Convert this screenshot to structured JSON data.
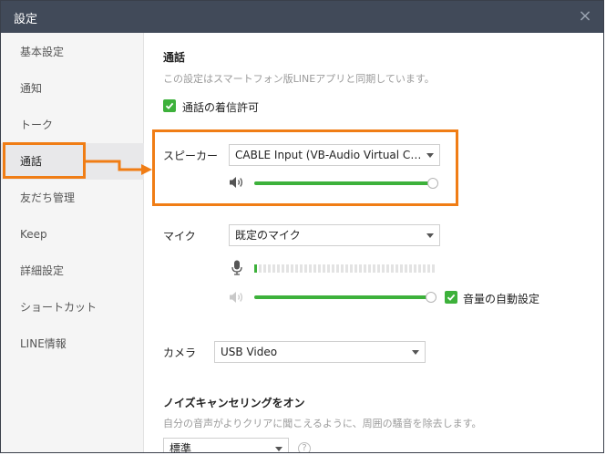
{
  "window": {
    "title": "設定",
    "close_glyph": "×"
  },
  "sidebar": {
    "items": [
      {
        "label": "基本設定"
      },
      {
        "label": "通知"
      },
      {
        "label": "トーク"
      },
      {
        "label": "通話",
        "active": true
      },
      {
        "label": "友だち管理"
      },
      {
        "label": "Keep"
      },
      {
        "label": "詳細設定"
      },
      {
        "label": "ショートカット"
      },
      {
        "label": "LINE情報"
      }
    ]
  },
  "call": {
    "heading": "通話",
    "description": "この設定はスマートフォン版LINEアプリと同期しています。",
    "allow_incoming": {
      "label": "通話の着信許可",
      "checked": true
    }
  },
  "speaker": {
    "label": "スピーカー",
    "selected": "CABLE Input (VB-Audio Virtual Cable)",
    "volume_percent": 100
  },
  "mic": {
    "label": "マイク",
    "selected": "既定のマイク",
    "level_segments_lit": 1,
    "volume_percent": 100,
    "auto_volume": {
      "label": "音量の自動設定",
      "checked": true
    }
  },
  "camera": {
    "label": "カメラ",
    "selected": "USB Video"
  },
  "noise": {
    "heading": "ノイズキャンセリングをオン",
    "description": "自分の音声がよりクリアに聞こえるように、周囲の騒音を除去します。",
    "selected": "標準",
    "help_glyph": "?"
  },
  "colors": {
    "accent_green": "#3db13b",
    "highlight_orange": "#f07d15",
    "titlebar": "#414a59"
  }
}
